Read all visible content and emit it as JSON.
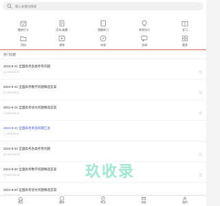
{
  "search": {
    "placeholder": "输入关键词搜索"
  },
  "quick_links": [
    {
      "label": "题库打卡",
      "icon": "calendar-check-icon"
    },
    {
      "label": "历年/真题",
      "icon": "document-icon"
    },
    {
      "label": "错题练习",
      "icon": "notebook-icon"
    },
    {
      "label": "常考技巧",
      "icon": "lightbulb-icon"
    },
    {
      "label": "学习",
      "icon": "book-icon"
    },
    {
      "label": "资料",
      "icon": "folder-icon"
    },
    {
      "label": "课堂",
      "icon": "play-icon"
    },
    {
      "label": "申请",
      "icon": "edit-icon"
    },
    {
      "label": "咨询",
      "icon": "chat-icon"
    },
    {
      "label": "更多",
      "icon": "grid-icon"
    }
  ],
  "list": {
    "header": "热门问题",
    "items": [
      {
        "title": "2024-9-21 全国高考各类考卷问题",
        "date": "2024-09-21",
        "highlight": false
      },
      {
        "title": "2024-9-21 全国高考数学问题精选答案",
        "date": "2024-09-21",
        "highlight": false
      },
      {
        "title": "2024-9-21 全国高考语文问题精选答案",
        "date": "2024-09-21",
        "highlight": false
      },
      {
        "title": "2024-9-21 全国高考英语问题汇总",
        "date": "2024-09-21",
        "highlight": true
      },
      {
        "title": "2024-9-20 全国高考各类考卷问题",
        "date": "2024-09-20",
        "highlight": false
      },
      {
        "title": "2024-9-20 全国高考数学问题精选答案",
        "date": "2024-09-20",
        "highlight": false
      },
      {
        "title": "2024-9-20 全国高考语文问题精选答案",
        "date": "2024-09-20",
        "highlight": false
      }
    ]
  },
  "watermark": "玖收录",
  "tabbar": [
    {
      "label": "首页",
      "icon": "home-icon"
    },
    {
      "label": "题库",
      "icon": "library-icon"
    },
    {
      "label": "考试",
      "icon": "exam-icon"
    },
    {
      "label": "消息",
      "icon": "message-icon"
    },
    {
      "label": "我的",
      "icon": "user-icon"
    }
  ],
  "colors": {
    "accent": "#e96a5f",
    "highlight_link": "#3c56d8",
    "watermark": "#7fe0c0"
  }
}
